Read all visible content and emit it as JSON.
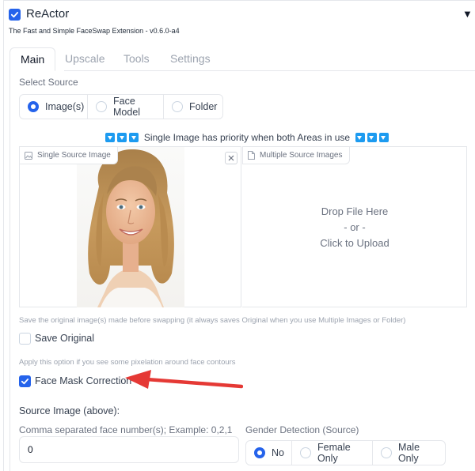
{
  "header": {
    "title": "ReActor",
    "subtitle": "The Fast and Simple FaceSwap Extension - v0.6.0-a4",
    "enabled": true,
    "collapse_glyph": "▼"
  },
  "tabs": [
    {
      "label": "Main",
      "active": true
    },
    {
      "label": "Upscale",
      "active": false
    },
    {
      "label": "Tools",
      "active": false
    },
    {
      "label": "Settings",
      "active": false
    }
  ],
  "select_source": {
    "label": "Select Source",
    "options": [
      "Image(s)",
      "Face Model",
      "Folder"
    ],
    "selected": "Image(s)"
  },
  "notice": {
    "text": "Single Image has priority when both Areas in use",
    "emoji": "🔽"
  },
  "single_source": {
    "label": "Single Source Image",
    "icon": "image-icon",
    "close_glyph": "×",
    "image_description": "portrait-photo"
  },
  "multiple_source": {
    "label": "Multiple Source Images",
    "icon": "file-icon",
    "drop_text": "Drop File Here",
    "or_text": "- or -",
    "upload_text": "Click to Upload"
  },
  "save_original": {
    "info": "Save the original image(s) made before swapping (it always saves Original when you use Multiple Images or Folder)",
    "label": "Save Original",
    "checked": false
  },
  "face_mask": {
    "info": "Apply this option if you see some pixelation around face contours",
    "label": "Face Mask Correction",
    "checked": true
  },
  "source_image": {
    "label": "Source Image (above):",
    "face_numbers_label": "Comma separated face number(s); Example: 0,2,1",
    "face_numbers_value": "0",
    "gender_label": "Gender Detection (Source)",
    "gender_options": [
      "No",
      "Female Only",
      "Male Only"
    ],
    "gender_selected": "No"
  },
  "colors": {
    "accent": "#2563eb",
    "annotation_arrow": "#e53935",
    "border": "#e5e7eb",
    "muted_text": "#9ca3af"
  }
}
